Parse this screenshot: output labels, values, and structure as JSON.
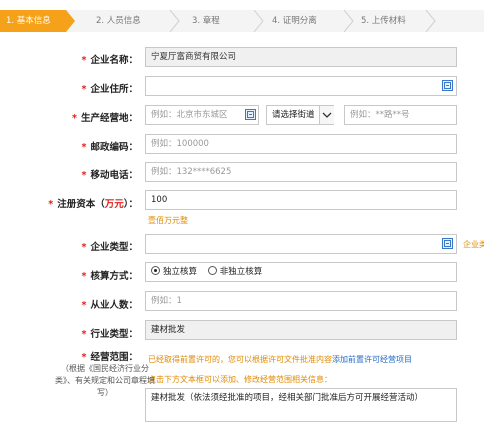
{
  "steps": [
    {
      "label": "1. 基本信息",
      "active": true
    },
    {
      "label": "2. 人员信息",
      "active": false
    },
    {
      "label": "3. 章程",
      "active": false
    },
    {
      "label": "4. 证明分离",
      "active": false
    },
    {
      "label": "5. 上传材料",
      "active": false
    }
  ],
  "form": {
    "company_name": {
      "label": "企业名称：",
      "value": "宁夏厅富商贸有限公司"
    },
    "address": {
      "label": "企业住所：",
      "value": ""
    },
    "business_address": {
      "label": "生产经营地：",
      "district_placeholder": "例如：北京市东城区",
      "street_select": "请选择街道",
      "detail_placeholder": "例如：**路**号"
    },
    "postal_code": {
      "label": "邮政编码：",
      "placeholder": "例如：100000"
    },
    "mobile": {
      "label": "移动电话：",
      "placeholder": "例如：132****6625"
    },
    "capital": {
      "label_prefix": "注册资本（",
      "label_unit": "万元",
      "label_suffix": "）：",
      "value": "100",
      "hint": "壹佰万元整"
    },
    "company_type": {
      "label": "企业类型：",
      "value": "",
      "side_hint": "企业类"
    },
    "accounting": {
      "label": "核算方式：",
      "option_independent": "独立核算",
      "option_non_independent": "非独立核算"
    },
    "employees": {
      "label": "从业人数：",
      "placeholder": "例如：1"
    },
    "industry": {
      "label": "行业类型：",
      "value": "建材批发"
    },
    "scope": {
      "label": "经营范围：",
      "note": "（根据《国民经济行业分类》、有关规定和公司章程填写）",
      "permit_hint": "已经取得前置许可的，您可以根据许可文件批准内容",
      "permit_link": "添加前置许可经营项目",
      "edit_hint": "点击下方文本框可以添加、修改经营范围相关信息：",
      "value": "建材批发（依法须经批准的项目，经相关部门批准后方可开展经营活动）"
    }
  }
}
